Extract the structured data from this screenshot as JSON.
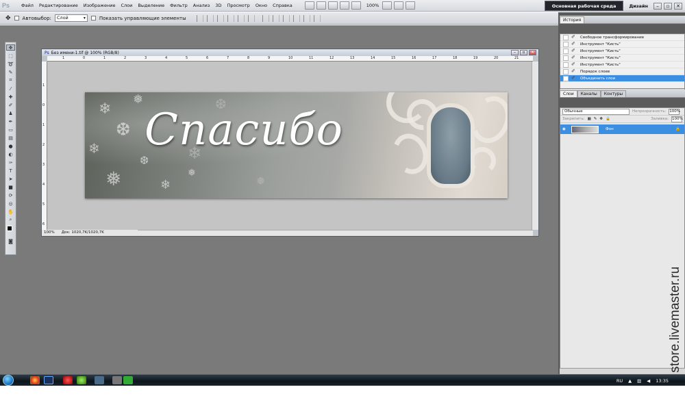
{
  "app": {
    "logo": "Ps"
  },
  "menu": [
    "Файл",
    "Редактирование",
    "Изображение",
    "Слои",
    "Выделение",
    "Фильтр",
    "Анализ",
    "3D",
    "Просмотр",
    "Окно",
    "Справка"
  ],
  "zoom": "100%",
  "workspace": {
    "active": "Основная рабочая среда",
    "other": "Дизайн"
  },
  "window_ctrls": {
    "minimize": "–",
    "restore": "▫",
    "close": "✕"
  },
  "options": {
    "autoselect": "Автовыбор:",
    "layer_select": "Слой",
    "show_controls": "Показать управляющие элементы"
  },
  "document": {
    "title": "Без имени-1.tif @ 100% (RGB/8)",
    "zoom": "100%",
    "doc_size": "Док: 1020,7K/1020,7K",
    "ruler_top": [
      "1",
      "0",
      "1",
      "2",
      "3",
      "4",
      "5",
      "6",
      "7",
      "8",
      "9",
      "10",
      "11",
      "12",
      "13",
      "14",
      "15",
      "16",
      "17",
      "18",
      "19",
      "20",
      "21"
    ],
    "ruler_left": [
      "1",
      "0",
      "1",
      "2",
      "3",
      "4",
      "5",
      "6",
      "7"
    ],
    "banner_text": "Спасибо"
  },
  "history": {
    "tab": "История",
    "items": [
      {
        "label": "Свободное трансформирование",
        "icon": "transform-icon"
      },
      {
        "label": "Инструмент \"Кисть\"",
        "icon": "brush-icon"
      },
      {
        "label": "Инструмент \"Кисть\"",
        "icon": "brush-icon"
      },
      {
        "label": "Инструмент \"Кисть\"",
        "icon": "brush-icon"
      },
      {
        "label": "Инструмент \"Кисть\"",
        "icon": "brush-icon"
      },
      {
        "label": "Порядок слоев",
        "icon": "layer-order-icon"
      },
      {
        "label": "Объединить слои",
        "icon": "merge-icon",
        "selected": true
      }
    ]
  },
  "layers": {
    "tabs": [
      "Слои",
      "Каналы",
      "Контуры"
    ],
    "blend_mode": "Обычные",
    "opacity_label": "Непрозрачность:",
    "opacity": "100%",
    "lock_label": "Закрепить:",
    "fill_label": "Заливка:",
    "fill": "100%",
    "layer_name": "Фон"
  },
  "taskbar": {
    "lang": "RU",
    "time": "13:35"
  },
  "watermark": "store.livemaster.ru",
  "colors": {
    "selection": "#3c8fe0",
    "workspace_bg": "#7a7a7a",
    "dock_bg": "#5b5b5b"
  }
}
